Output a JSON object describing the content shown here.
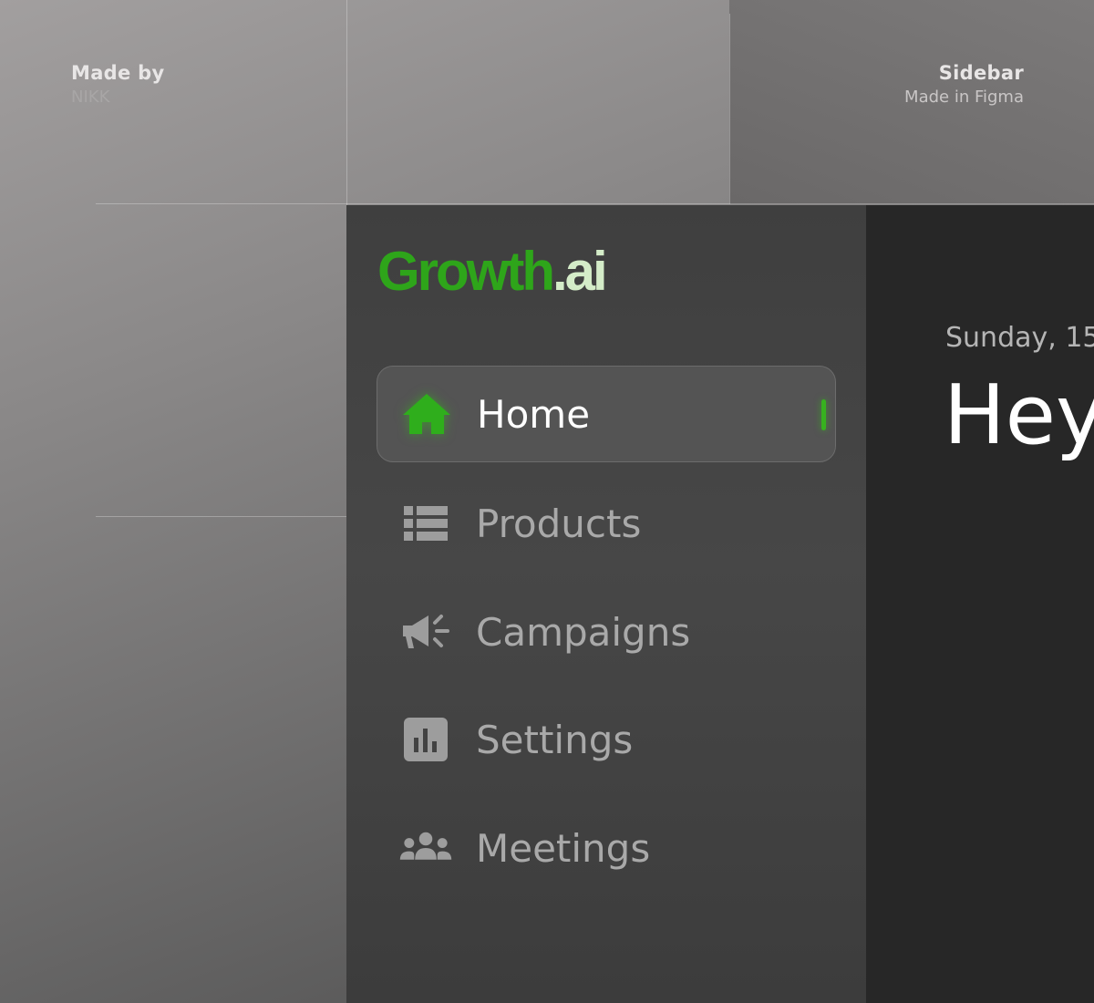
{
  "meta": {
    "made_by_label": "Made by",
    "author": "NIKK",
    "title": "Sidebar",
    "subtitle": "Made in Figma"
  },
  "brand": {
    "name": "Growth",
    "suffix": ".ai",
    "primary_color": "#2ea51a",
    "suffix_color": "#d4ecc8"
  },
  "sidebar": {
    "items": [
      {
        "label": "Home",
        "icon": "home-icon",
        "active": true
      },
      {
        "label": "Products",
        "icon": "list-icon",
        "active": false
      },
      {
        "label": "Campaigns",
        "icon": "megaphone-icon",
        "active": false
      },
      {
        "label": "Settings",
        "icon": "bar-chart-icon",
        "active": false
      },
      {
        "label": "Meetings",
        "icon": "users-icon",
        "active": false
      }
    ],
    "active_color": "#37b21f",
    "inactive_icon_color": "#9d9d9d"
  },
  "main": {
    "date": "Sunday, 15",
    "greeting": "Hey"
  }
}
